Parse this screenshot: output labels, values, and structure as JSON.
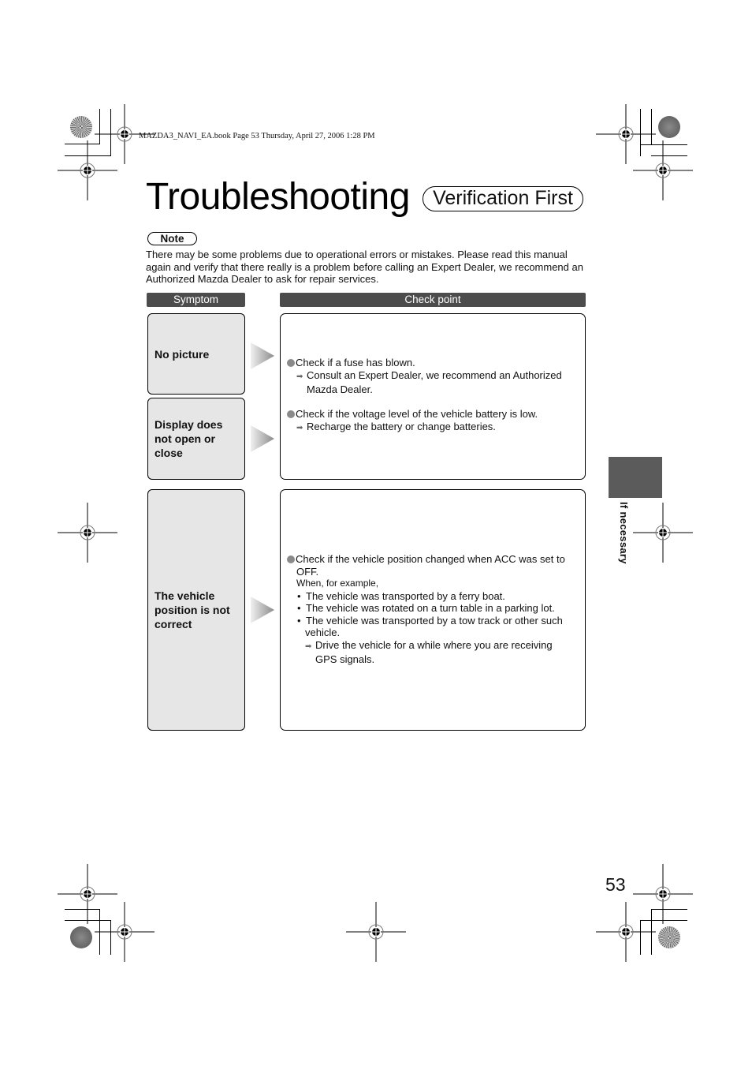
{
  "header": {
    "book_info": "MAZDA3_NAVI_EA.book  Page 53  Thursday, April 27, 2006  1:28 PM"
  },
  "title": {
    "main": "Troubleshooting",
    "subtitle": "Verification First"
  },
  "note": {
    "label": "Note",
    "text": "There may be some problems due to operational errors or mistakes. Please read this manual again and verify that there really is a problem before calling an Expert Dealer, we recommend an Authorized Mazda Dealer to ask for repair services."
  },
  "table": {
    "headers": {
      "symptom": "Symptom",
      "check_point": "Check point"
    },
    "symptoms": [
      {
        "label": "No picture"
      },
      {
        "label": "Display does not open or close"
      },
      {
        "label": "The vehicle position is not correct"
      }
    ],
    "check_groups": [
      {
        "items": [
          {
            "check": "Check if a fuse has blown.",
            "action_lines": [
              "Consult an Expert Dealer, we recommend an Authorized",
              "Mazda Dealer."
            ]
          },
          {
            "check": "Check if the voltage level of the vehicle battery is low.",
            "action_lines": [
              "Recharge the battery or change batteries."
            ]
          }
        ]
      },
      {
        "items": [
          {
            "check_lines": [
              "Check if the vehicle position changed when ACC was set to",
              "OFF."
            ],
            "intro": "When, for example,",
            "bullets": [
              [
                "The vehicle was transported by a ferry boat."
              ],
              [
                "The vehicle was rotated on a turn table in a parking lot."
              ],
              [
                "The vehicle was transported by a tow track or other such",
                "vehicle."
              ]
            ],
            "action_lines": [
              "Drive the vehicle for a while where you are receiving",
              "GPS signals."
            ]
          }
        ]
      }
    ]
  },
  "side_tab": {
    "label": "If necessary"
  },
  "page_number": "53",
  "icons": {
    "bullet": "filled-circle",
    "arrow": "right-arrow",
    "registration_mark": "crosshair-target",
    "color_disc": "printer-color-disc"
  }
}
